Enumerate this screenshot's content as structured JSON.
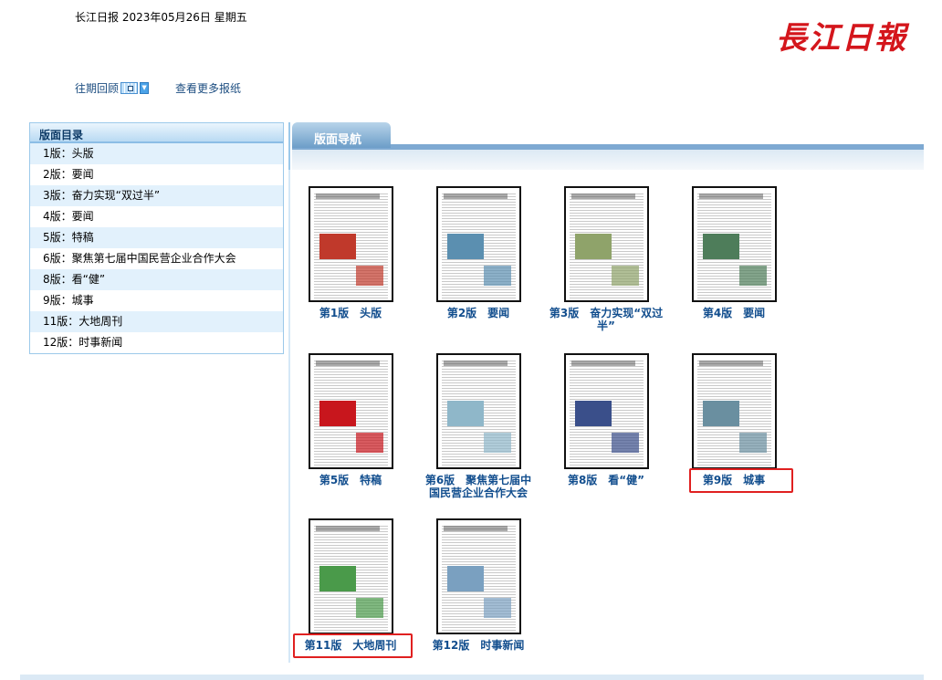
{
  "header": {
    "dateline": "长江日报 2023年05月26日 星期五",
    "logo": "长江日报",
    "archive_label": "往期回顾",
    "more_label": "查看更多报纸"
  },
  "toc": {
    "title": "版面目录",
    "items": [
      "1版：头版",
      "2版：要闻",
      "3版：奋力实现“双过半”",
      "4版：要闻",
      "5版：特稿",
      "6版：聚焦第七届中国民营企业合作大会",
      "8版：看“健”",
      "9版：城事",
      "11版：大地周刊",
      "12版：时事新闻"
    ]
  },
  "nav": {
    "title": "版面导航",
    "pages": [
      {
        "label": "第1版　头版",
        "color": "#c0392b"
      },
      {
        "label": "第2版　要闻",
        "color": "#5b8fb0"
      },
      {
        "label": "第3版　奋力实现“双过半”",
        "color": "#8fa36a"
      },
      {
        "label": "第4版　要闻",
        "color": "#4e7d5a"
      },
      {
        "label": "第5版　特稿",
        "color": "#c8161d"
      },
      {
        "label": "第6版　聚焦第七届中国民营企业合作大会",
        "color": "#8fb7c9"
      },
      {
        "label": "第8版　看“健”",
        "color": "#3a4f8a"
      },
      {
        "label": "第9版　城事",
        "color": "#6a8fa0"
      },
      {
        "label": "第11版　大地周刊",
        "color": "#4a9a4a"
      },
      {
        "label": "第12版　时事新闻",
        "color": "#7aa0c0"
      }
    ],
    "highlighted": [
      7,
      8
    ]
  }
}
